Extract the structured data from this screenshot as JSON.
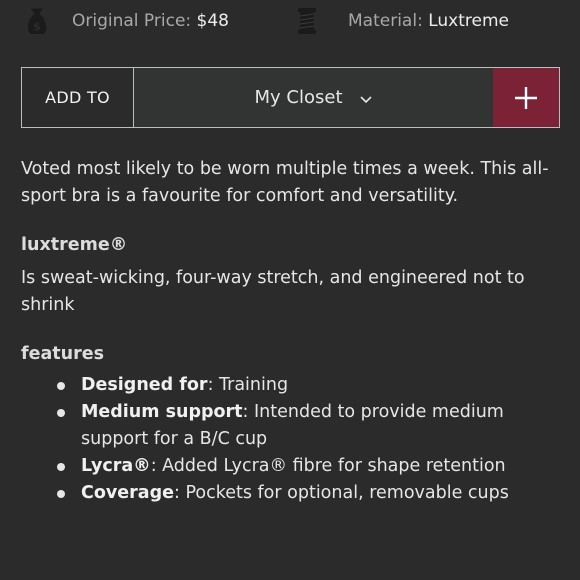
{
  "attributes": {
    "price_label": "Original Price:",
    "price_value": "$48",
    "price_icon": "money-bag-icon",
    "material_label": "Material:",
    "material_value": "Luxtreme",
    "material_icon": "thread-spool-icon"
  },
  "add_bar": {
    "add_to_label": "ADD TO",
    "closet_value": "My Closet",
    "plus_label": "+",
    "accent_color": "#7b2236"
  },
  "description": "Voted most likely to be worn multiple times a week. This all-sport bra is a favourite for comfort and versatility.",
  "fabric": {
    "heading": "luxtreme®",
    "text": "Is sweat-wicking, four-way stretch, and engineered not to shrink"
  },
  "features": {
    "heading": "features",
    "items": [
      {
        "title": "Designed for",
        "text": ": Training"
      },
      {
        "title": "Medium support",
        "text": ": Intended to provide medium support for a B/C cup"
      },
      {
        "title": "Lycra®",
        "text": ": Added Lycra® fibre for shape retention"
      },
      {
        "title": "Coverage",
        "text": ": Pockets for optional, removable cups"
      }
    ]
  }
}
